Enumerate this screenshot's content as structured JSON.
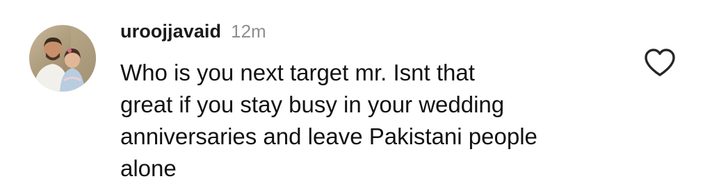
{
  "comment": {
    "username": "uroojjavaid",
    "timestamp": "12m",
    "text_lines": [
      "Who is you next target mr. Isnt that",
      "great if you stay busy in your wedding",
      "anniversaries and leave Pakistani people",
      "alone"
    ],
    "avatar_icon": "profile-photo-avatar",
    "like_icon": "heart-outline-icon"
  },
  "colors": {
    "username": "#1a1a1a",
    "timestamp": "#8e8e8e",
    "text": "#111111",
    "icon_stroke": "#262626",
    "background": "#ffffff"
  }
}
